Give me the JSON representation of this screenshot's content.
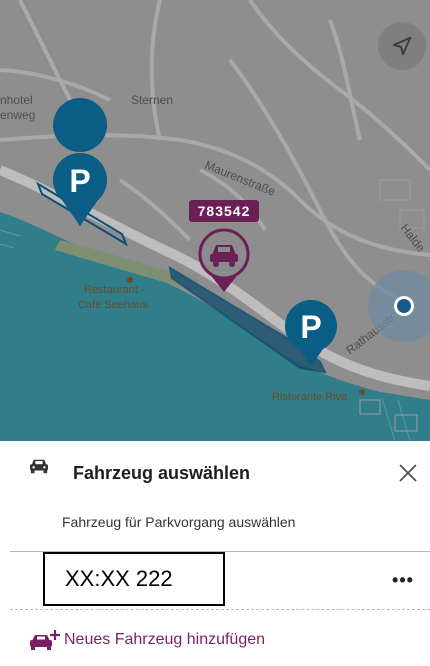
{
  "map": {
    "labels": {
      "hotel_line1": "nhotel",
      "hotel_line2": "enweg",
      "sternen": "Sternen",
      "maurenstrasse": "Maurenstraße",
      "halde": "Halde",
      "rathausstr": "Rathausstr",
      "restaurant_line1": "Restaurant -",
      "restaurant_line2": "Cafe Seehaus",
      "ristorante": "Ristorante Riva"
    },
    "selected_marker_id": "783542",
    "parking_symbol": "P",
    "colors": {
      "land": "#8d8d8d",
      "water": "#2f7e8a",
      "parking": "#0a5e86",
      "accent": "#7a1f63"
    }
  },
  "sheet": {
    "title": "Fahrzeug auswählen",
    "subtitle": "Fahrzeug für Parkvorgang auswählen",
    "vehicle_plate": "XX:XX 222",
    "more_label": "•••",
    "add_vehicle_label": "Neues Fahrzeug hinzufügen",
    "icons": {
      "header": "car-icon",
      "close": "close-icon",
      "add": "add-car-icon",
      "locate": "navigation-arrow-icon"
    }
  }
}
